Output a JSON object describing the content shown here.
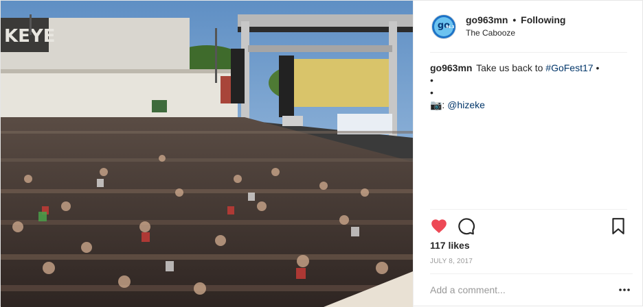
{
  "post": {
    "image_description_icon": "concert-crowd-photo",
    "user": {
      "username": "go963mn",
      "separator": "•",
      "follow_status": "Following",
      "location": "The Cabooze",
      "avatar_text": "go",
      "avatar_subtext": "96.3"
    },
    "caption": {
      "username": "go963mn",
      "text": "Take us back to",
      "hashtag": "#GoFest17",
      "trail": "•",
      "dots": [
        "•",
        "•"
      ],
      "credit_prefix": "📷:",
      "credit_user": "@hizeke"
    },
    "actions": {
      "like_icon": "heart-icon",
      "comment_icon": "comment-icon",
      "save_icon": "bookmark-icon",
      "liked": true,
      "like_color": "#ed4956"
    },
    "likes": "117 likes",
    "date": "JULY 8, 2017",
    "comment": {
      "placeholder": "Add a comment...",
      "more_icon": "more-options-icon"
    }
  }
}
